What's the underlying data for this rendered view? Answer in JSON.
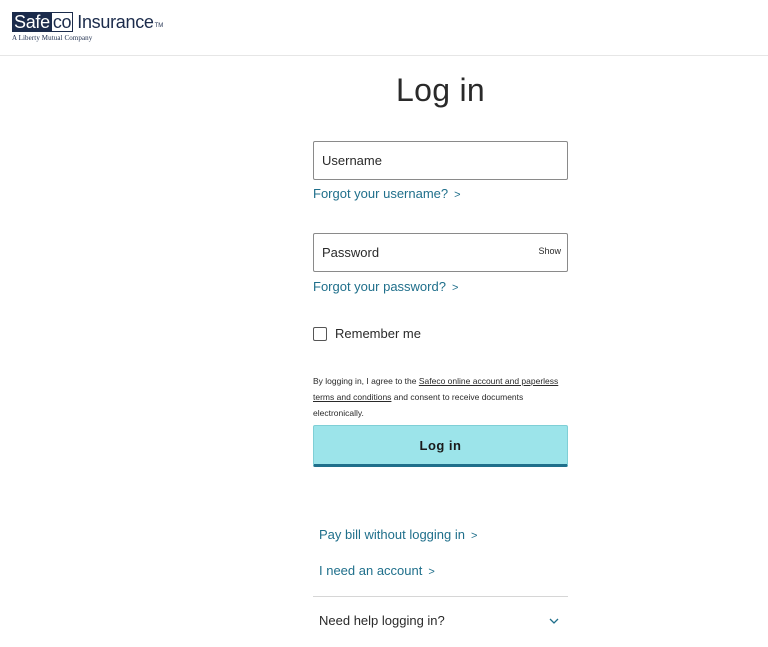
{
  "header": {
    "logo_part1": "Safe",
    "logo_part2": "co",
    "logo_part3": "Insurance",
    "logo_tm": "TM",
    "logo_tagline": "A Liberty Mutual Company"
  },
  "form": {
    "title": "Log in",
    "username": {
      "placeholder": "Username",
      "value": ""
    },
    "forgot_username": "Forgot your username?",
    "password": {
      "placeholder": "Password",
      "value": ""
    },
    "show_label": "Show",
    "forgot_password": "Forgot your password?",
    "remember_me": "Remember me",
    "terms": {
      "prefix": "By logging in, I agree to the ",
      "link": "Safeco online account and paperless terms and conditions",
      "suffix": " and consent to receive documents electronically."
    },
    "login_button": "Log in"
  },
  "links": {
    "pay_bill": "Pay bill without logging in",
    "need_account": "I need an account",
    "help": "Need help logging in?"
  },
  "colors": {
    "brand_navy": "#1b2b4b",
    "link": "#1f6f8b",
    "button_bg": "#9ce4ea"
  }
}
